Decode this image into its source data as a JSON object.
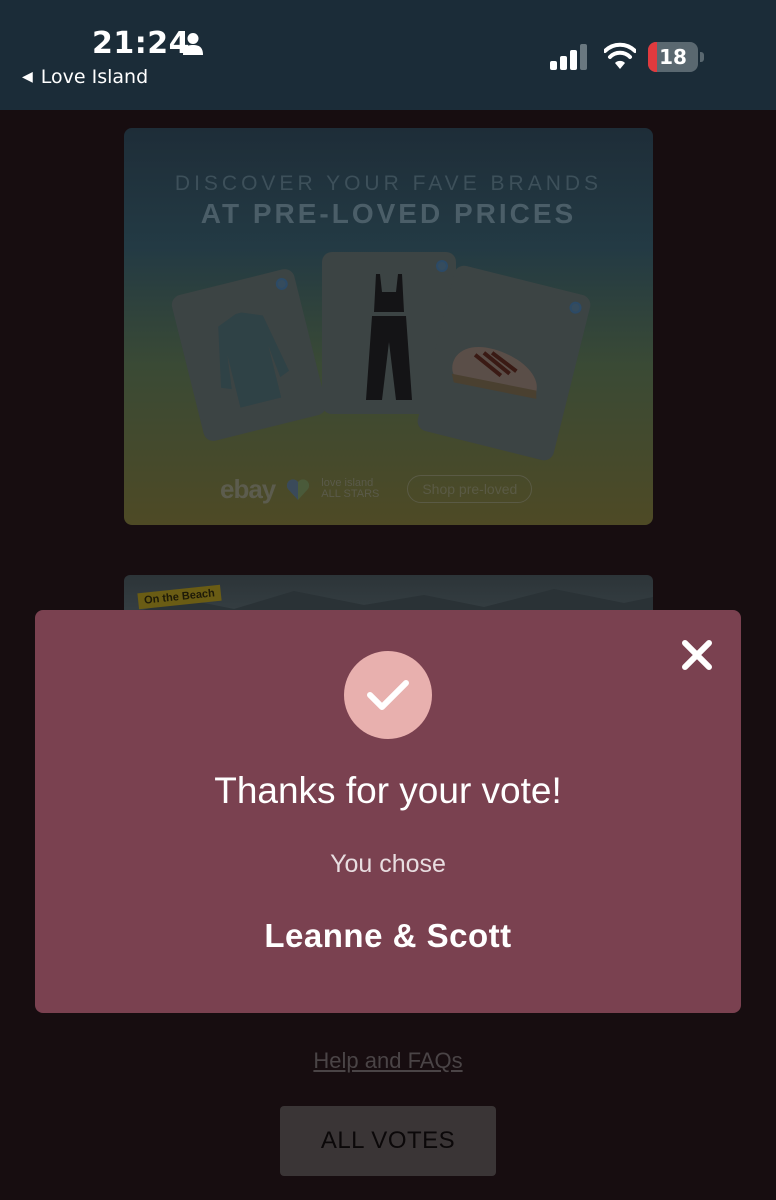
{
  "status_bar": {
    "time": "21:24",
    "back_app": "Love Island",
    "battery_level": "18",
    "battery_fraction": 0.18
  },
  "ads": {
    "ebay": {
      "headline_line1": "DISCOVER YOUR FAVE BRANDS",
      "headline_line2": "AT PRE-LOVED PRICES",
      "brand": "ebay",
      "partner_line1": "love island",
      "partner_line2": "ALL STARS",
      "cta": "Shop pre-loved"
    },
    "beach": {
      "logo_line1": "On the",
      "logo_line2": "Beach"
    }
  },
  "modal": {
    "title": "Thanks for your vote!",
    "subtitle": "You chose",
    "choice": "Leanne & Scott"
  },
  "footer": {
    "help_link": "Help and FAQs",
    "all_votes_button": "ALL VOTES"
  },
  "colors": {
    "modal_bg": "#7a4150",
    "check_circle": "#e8b0ae",
    "status_bar_bg": "#1b2c38",
    "page_bg": "#170d10"
  },
  "icons": [
    "person-icon",
    "signal-icon",
    "wifi-icon",
    "battery-icon",
    "check-icon",
    "close-icon",
    "back-caret-icon"
  ]
}
